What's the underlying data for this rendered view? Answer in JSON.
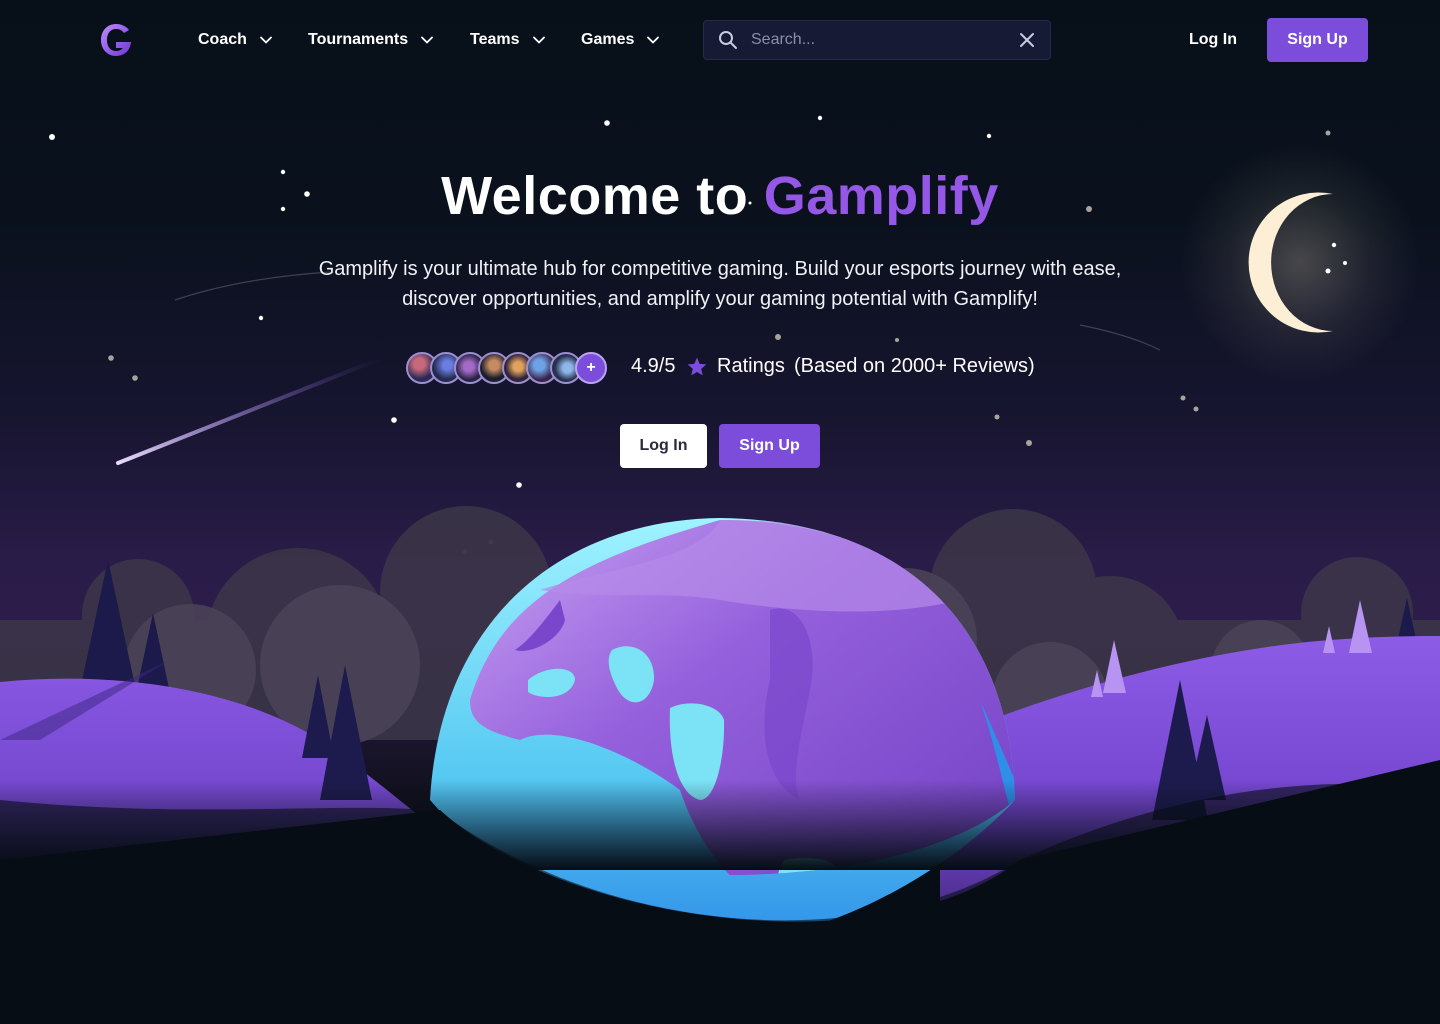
{
  "nav": {
    "logo_icon": "gamplify-g-logo-icon",
    "items": [
      {
        "label": "Coach",
        "icon": "chevron-down-icon"
      },
      {
        "label": "Tournaments",
        "icon": "chevron-down-icon"
      },
      {
        "label": "Teams",
        "icon": "chevron-down-icon"
      },
      {
        "label": "Games",
        "icon": "chevron-down-icon"
      }
    ],
    "search": {
      "placeholder": "Search...",
      "value": "",
      "icon": "search-icon",
      "clear_icon": "close-icon"
    },
    "login_label": "Log In",
    "signup_label": "Sign Up"
  },
  "hero": {
    "title_prefix": "Welcome to",
    "title_brand": "Gamplify",
    "description": "Gamplify is your ultimate hub for competitive gaming. Build your esports journey with ease, discover opportunities, and amplify your gaming potential with Gamplify!",
    "rating": {
      "avatar_count": 7,
      "plus_label": "+",
      "score": "4.9/5",
      "star_icon": "star-icon",
      "label": "Ratings",
      "based_on": "(Based on 2000+ Reviews)"
    },
    "login_label": "Log In",
    "signup_label": "Sign Up"
  },
  "colors": {
    "accent": "#7c4ddb",
    "brand_text": "#9457e6",
    "background": "#060d14",
    "moon": "#fdefd6",
    "globe_water": "#5fd8f5",
    "globe_land": "#8e57d9"
  }
}
